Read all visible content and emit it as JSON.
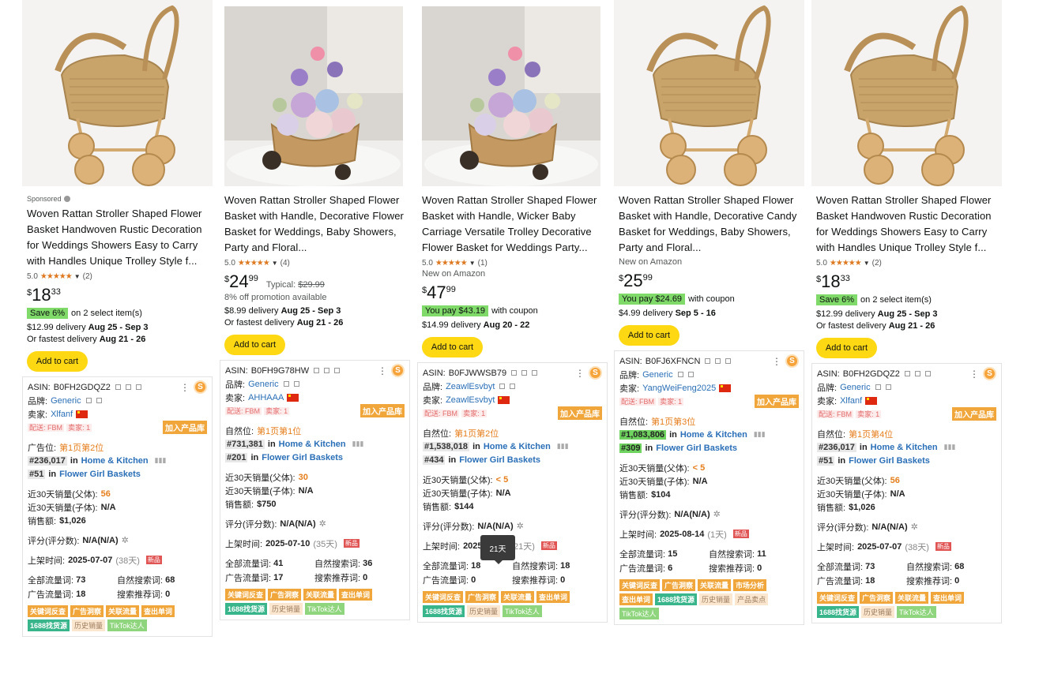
{
  "products": [
    {
      "sponsored": "Sponsored",
      "title": "Woven Rattan Stroller Shaped Flower Basket Handwoven Rustic Decoration for Weddings Showers Easy to Carry with Handles Unique Trolley Style f...",
      "rating": "5.0",
      "rating_count": "(2)",
      "new_on_amazon": "",
      "price_symbol": "$",
      "price_whole": "18",
      "price_frac": "33",
      "typical_label": "",
      "typical_price": "",
      "promo": "",
      "save_badge": "Save 6%",
      "save_text": "on 2 select item(s)",
      "delivery_prefix": "$12.99 delivery",
      "delivery_dates": "Aug 25 - Sep 3",
      "fastest_prefix": "Or fastest delivery",
      "fastest_dates": "Aug 21 - 26",
      "add_to_cart": "Add to cart",
      "plugin": {
        "asin_label": "ASIN:",
        "asin": "B0FH2GDQZ2",
        "brand_label": "品牌:",
        "brand": "Generic",
        "seller_label": "卖家:",
        "seller": "Xlfanf",
        "fbm": "配送: FBM",
        "sellers_count": "卖家: 1",
        "add_lib": "加入产品库",
        "position_label": "广告位:",
        "position": "第1页第2位",
        "rank1": "#236,017",
        "rank1_in": "in",
        "rank1_cat": "Home & Kitchen",
        "rank2": "#51",
        "rank2_in": "in",
        "rank2_cat": "Flower Girl Baskets",
        "sales_parent_label": "近30天销量(父体):",
        "sales_parent": "56",
        "sales_child_label": "近30天销量(子体):",
        "sales_child": "N/A",
        "revenue_label": "销售额:",
        "revenue": "$1,026",
        "review_label": "评分(评分数):",
        "review": "N/A(N/A)",
        "listed_label": "上架时间:",
        "listed": "2025-07-07",
        "listed_days": "(38天)",
        "new_tag": "新品",
        "kw_all_label": "全部流量词:",
        "kw_all": "73",
        "kw_org_label": "自然搜索词:",
        "kw_org": "68",
        "kw_ad_label": "广告流量词:",
        "kw_ad": "18",
        "kw_rec_label": "搜索推荐词:",
        "kw_rec": "0",
        "tags": [
          "关键词反查",
          "广告洞察",
          "关联流量",
          "查出单词",
          "1688找货源",
          "历史销量",
          "TikTok达人"
        ]
      }
    },
    {
      "sponsored": "",
      "title": "Woven Rattan Stroller Shaped Flower Basket with Handle, Decorative Flower Basket for Weddings, Baby Showers, Party and Floral...",
      "rating": "5.0",
      "rating_count": "(4)",
      "new_on_amazon": "",
      "price_symbol": "$",
      "price_whole": "24",
      "price_frac": "99",
      "typical_label": "Typical:",
      "typical_price": "$29.99",
      "promo": "8% off promotion available",
      "save_badge": "",
      "save_text": "",
      "delivery_prefix": "$8.99 delivery",
      "delivery_dates": "Aug 25 - Sep 3",
      "fastest_prefix": "Or fastest delivery",
      "fastest_dates": "Aug 21 - 26",
      "add_to_cart": "Add to cart",
      "plugin": {
        "asin_label": "ASIN:",
        "asin": "B0FH9G78HW",
        "brand_label": "品牌:",
        "brand": "Generic",
        "seller_label": "卖家:",
        "seller": "AHHAAA",
        "fbm": "配送: FBM",
        "sellers_count": "卖家: 1",
        "add_lib": "加入产品库",
        "position_label": "自然位:",
        "position": "第1页第1位",
        "rank1": "#731,381",
        "rank1_in": "in",
        "rank1_cat": "Home & Kitchen",
        "rank2": "#201",
        "rank2_in": "in",
        "rank2_cat": "Flower Girl Baskets",
        "sales_parent_label": "近30天销量(父体):",
        "sales_parent": "30",
        "sales_child_label": "近30天销量(子体):",
        "sales_child": "N/A",
        "revenue_label": "销售额:",
        "revenue": "$750",
        "review_label": "评分(评分数):",
        "review": "N/A(N/A)",
        "listed_label": "上架时间:",
        "listed": "2025-07-10",
        "listed_days": "(35天)",
        "new_tag": "新品",
        "kw_all_label": "全部流量词:",
        "kw_all": "41",
        "kw_org_label": "自然搜索词:",
        "kw_org": "36",
        "kw_ad_label": "广告流量词:",
        "kw_ad": "17",
        "kw_rec_label": "搜索推荐词:",
        "kw_rec": "0",
        "tags": [
          "关键词反查",
          "广告洞察",
          "关联流量",
          "查出单词",
          "1688找货源",
          "历史销量",
          "TikTok达人"
        ]
      }
    },
    {
      "sponsored": "",
      "title": "Woven Rattan Stroller Shaped Flower Basket with Handle, Wicker Baby Carriage Versatile Trolley Decorative Flower Basket for Weddings Party...",
      "rating": "5.0",
      "rating_count": "(1)",
      "new_on_amazon": "New on Amazon",
      "price_symbol": "$",
      "price_whole": "47",
      "price_frac": "99",
      "typical_label": "",
      "typical_price": "",
      "promo": "",
      "save_badge": "You pay $43.19",
      "save_text": "with coupon",
      "delivery_prefix": "$14.99 delivery",
      "delivery_dates": "Aug 20 - 22",
      "fastest_prefix": "",
      "fastest_dates": "",
      "add_to_cart": "Add to cart",
      "plugin": {
        "asin_label": "ASIN:",
        "asin": "B0FJWWSB79",
        "brand_label": "品牌:",
        "brand": "ZeawlEsvbyt",
        "seller_label": "卖家:",
        "seller": "ZeawlEsvbyt",
        "fbm": "配送: FBM",
        "sellers_count": "卖家: 1",
        "add_lib": "加入产品库",
        "position_label": "自然位:",
        "position": "第1页第2位",
        "rank1": "#1,538,018",
        "rank1_in": "in",
        "rank1_cat": "Home & Kitchen",
        "rank2": "#434",
        "rank2_in": "in",
        "rank2_cat": "Flower Girl Baskets",
        "sales_parent_label": "近30天销量(父体):",
        "sales_parent": "< 5",
        "sales_child_label": "近30天销量(子体):",
        "sales_child": "N/A",
        "revenue_label": "销售额:",
        "revenue": "$144",
        "review_label": "评分(评分数):",
        "review": "N/A(N/A)",
        "listed_label": "上架时间:",
        "listed": "2025-07-24",
        "listed_days": "(21天)",
        "new_tag": "新品",
        "kw_all_label": "全部流量词:",
        "kw_all": "18",
        "kw_org_label": "自然搜索词:",
        "kw_org": "18",
        "kw_ad_label": "广告流量词:",
        "kw_ad": "0",
        "kw_rec_label": "搜索推荐词:",
        "kw_rec": "0",
        "tags": [
          "关键词反查",
          "广告洞察",
          "关联流量",
          "查出单词",
          "1688找货源",
          "历史销量",
          "TikTok达人"
        ]
      }
    },
    {
      "sponsored": "",
      "title": "Woven Rattan Stroller Shaped Flower Basket with Handle, Decorative Candy Basket for Weddings, Baby Showers, Party and Floral...",
      "rating": "",
      "rating_count": "",
      "new_on_amazon": "New on Amazon",
      "price_symbol": "$",
      "price_whole": "25",
      "price_frac": "99",
      "typical_label": "",
      "typical_price": "",
      "promo": "",
      "save_badge": "You pay $24.69",
      "save_text": "with coupon",
      "delivery_prefix": "$4.99 delivery",
      "delivery_dates": "Sep 5 - 16",
      "fastest_prefix": "",
      "fastest_dates": "",
      "add_to_cart": "Add to cart",
      "plugin": {
        "asin_label": "ASIN:",
        "asin": "B0FJ6XFNCN",
        "brand_label": "品牌:",
        "brand": "Generic",
        "seller_label": "卖家:",
        "seller": "YangWeiFeng2025",
        "fbm": "配送: FBM",
        "sellers_count": "卖家: 1",
        "add_lib": "加入产品库",
        "position_label": "自然位:",
        "position": "第1页第3位",
        "rank1": "#1,083,806",
        "rank1_in": "in",
        "rank1_cat": "Home & Kitchen",
        "rank2": "#309",
        "rank2_in": "in",
        "rank2_cat": "Flower Girl Baskets",
        "sales_parent_label": "近30天销量(父体):",
        "sales_parent": "< 5",
        "sales_child_label": "近30天销量(子体):",
        "sales_child": "N/A",
        "revenue_label": "销售额:",
        "revenue": "$104",
        "review_label": "评分(评分数):",
        "review": "N/A(N/A)",
        "listed_label": "上架时间:",
        "listed": "2025-08-14",
        "listed_days": "(1天)",
        "new_tag": "新品",
        "kw_all_label": "全部流量词:",
        "kw_all": "15",
        "kw_org_label": "自然搜索词:",
        "kw_org": "11",
        "kw_ad_label": "广告流量词:",
        "kw_ad": "6",
        "kw_rec_label": "搜索推荐词:",
        "kw_rec": "0",
        "tags": [
          "关键词反查",
          "广告洞察",
          "关联流量",
          "市场分析",
          "查出单词",
          "1688找货源",
          "历史销量",
          "产品卖点",
          "TikTok达人"
        ]
      }
    },
    {
      "sponsored": "",
      "title": "Woven Rattan Stroller Shaped Flower Basket Handwoven Rustic Decoration for Weddings Showers Easy to Carry with Handles Unique Trolley Style f...",
      "rating": "5.0",
      "rating_count": "(2)",
      "new_on_amazon": "",
      "price_symbol": "$",
      "price_whole": "18",
      "price_frac": "33",
      "typical_label": "",
      "typical_price": "",
      "promo": "",
      "save_badge": "Save 6%",
      "save_text": "on 2 select item(s)",
      "delivery_prefix": "$12.99 delivery",
      "delivery_dates": "Aug 25 - Sep 3",
      "fastest_prefix": "Or fastest delivery",
      "fastest_dates": "Aug 21 - 26",
      "add_to_cart": "Add to cart",
      "plugin": {
        "asin_label": "ASIN:",
        "asin": "B0FH2GDQZ2",
        "brand_label": "品牌:",
        "brand": "Generic",
        "seller_label": "卖家:",
        "seller": "Xlfanf",
        "fbm": "配送: FBM",
        "sellers_count": "卖家: 1",
        "add_lib": "加入产品库",
        "position_label": "自然位:",
        "position": "第1页第4位",
        "rank1": "#236,017",
        "rank1_in": "in",
        "rank1_cat": "Home & Kitchen",
        "rank2": "#51",
        "rank2_in": "in",
        "rank2_cat": "Flower Girl Baskets",
        "sales_parent_label": "近30天销量(父体):",
        "sales_parent": "56",
        "sales_child_label": "近30天销量(子体):",
        "sales_child": "N/A",
        "revenue_label": "销售额:",
        "revenue": "$1,026",
        "review_label": "评分(评分数):",
        "review": "N/A(N/A)",
        "listed_label": "上架时间:",
        "listed": "2025-07-07",
        "listed_days": "(38天)",
        "new_tag": "新品",
        "kw_all_label": "全部流量词:",
        "kw_all": "73",
        "kw_org_label": "自然搜索词:",
        "kw_org": "68",
        "kw_ad_label": "广告流量词:",
        "kw_ad": "18",
        "kw_rec_label": "搜索推荐词:",
        "kw_rec": "0",
        "tags": [
          "关键词反查",
          "广告洞察",
          "关联流量",
          "查出单词",
          "1688找货源",
          "历史销量",
          "TikTok达人"
        ]
      }
    }
  ],
  "tooltip": "21天",
  "colors": {
    "add_to_cart": "#ffd814",
    "save_badge": "#7fda69",
    "star": "#de7921",
    "plugin_orange": "#f0a63a",
    "link_blue": "#2a6fb7"
  }
}
